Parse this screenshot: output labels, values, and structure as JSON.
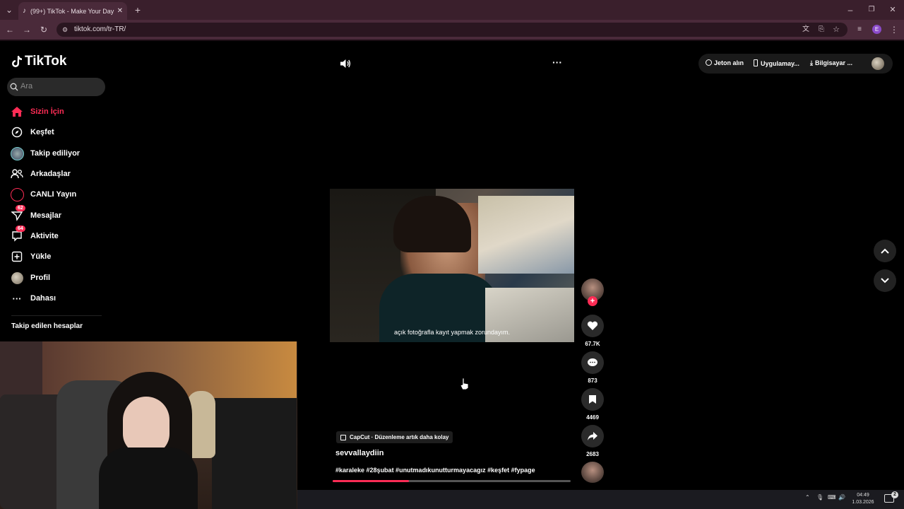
{
  "browser": {
    "tab_title": "(99+) TikTok - Make Your Day",
    "url": "tiktok.com/tr-TR/"
  },
  "sidebar": {
    "logo_text": "TikTok",
    "search_placeholder": "Ara",
    "items": [
      {
        "label": "Sizin İçin",
        "active": true
      },
      {
        "label": "Keşfet"
      },
      {
        "label": "Takip ediliyor"
      },
      {
        "label": "Arkadaşlar"
      },
      {
        "label": "CANLI Yayın"
      },
      {
        "label": "Mesajlar",
        "badge": "62"
      },
      {
        "label": "Aktivite",
        "badge": "64"
      },
      {
        "label": "Yükle"
      },
      {
        "label": "Profil"
      },
      {
        "label": "Dahası"
      }
    ],
    "following_title": "Takip edilen hesaplar"
  },
  "topbar": {
    "coins": "Jeton alın",
    "app": "Uygulamay...",
    "desktop": "Bilgisayar ..."
  },
  "video": {
    "subtitle": "açık fotoğrafla kayıt yapmak zorundayım.",
    "capcut": "CapCut · Düzenleme artık daha kolay",
    "username": "sevvallaydiin",
    "hashtags": "#karaleke #28şubat #unutmadıkunutturmayacagız #keşfet #fypage",
    "progress": 0.32
  },
  "actions": {
    "likes": "67.7K",
    "comments": "873",
    "saves": "4469",
    "shares": "2683"
  },
  "taskbar": {
    "time": "04:49",
    "date": "1.03.2026",
    "notifications": "2"
  },
  "colors": {
    "accent": "#fe2c55",
    "chrome": "#4a2a3a"
  }
}
